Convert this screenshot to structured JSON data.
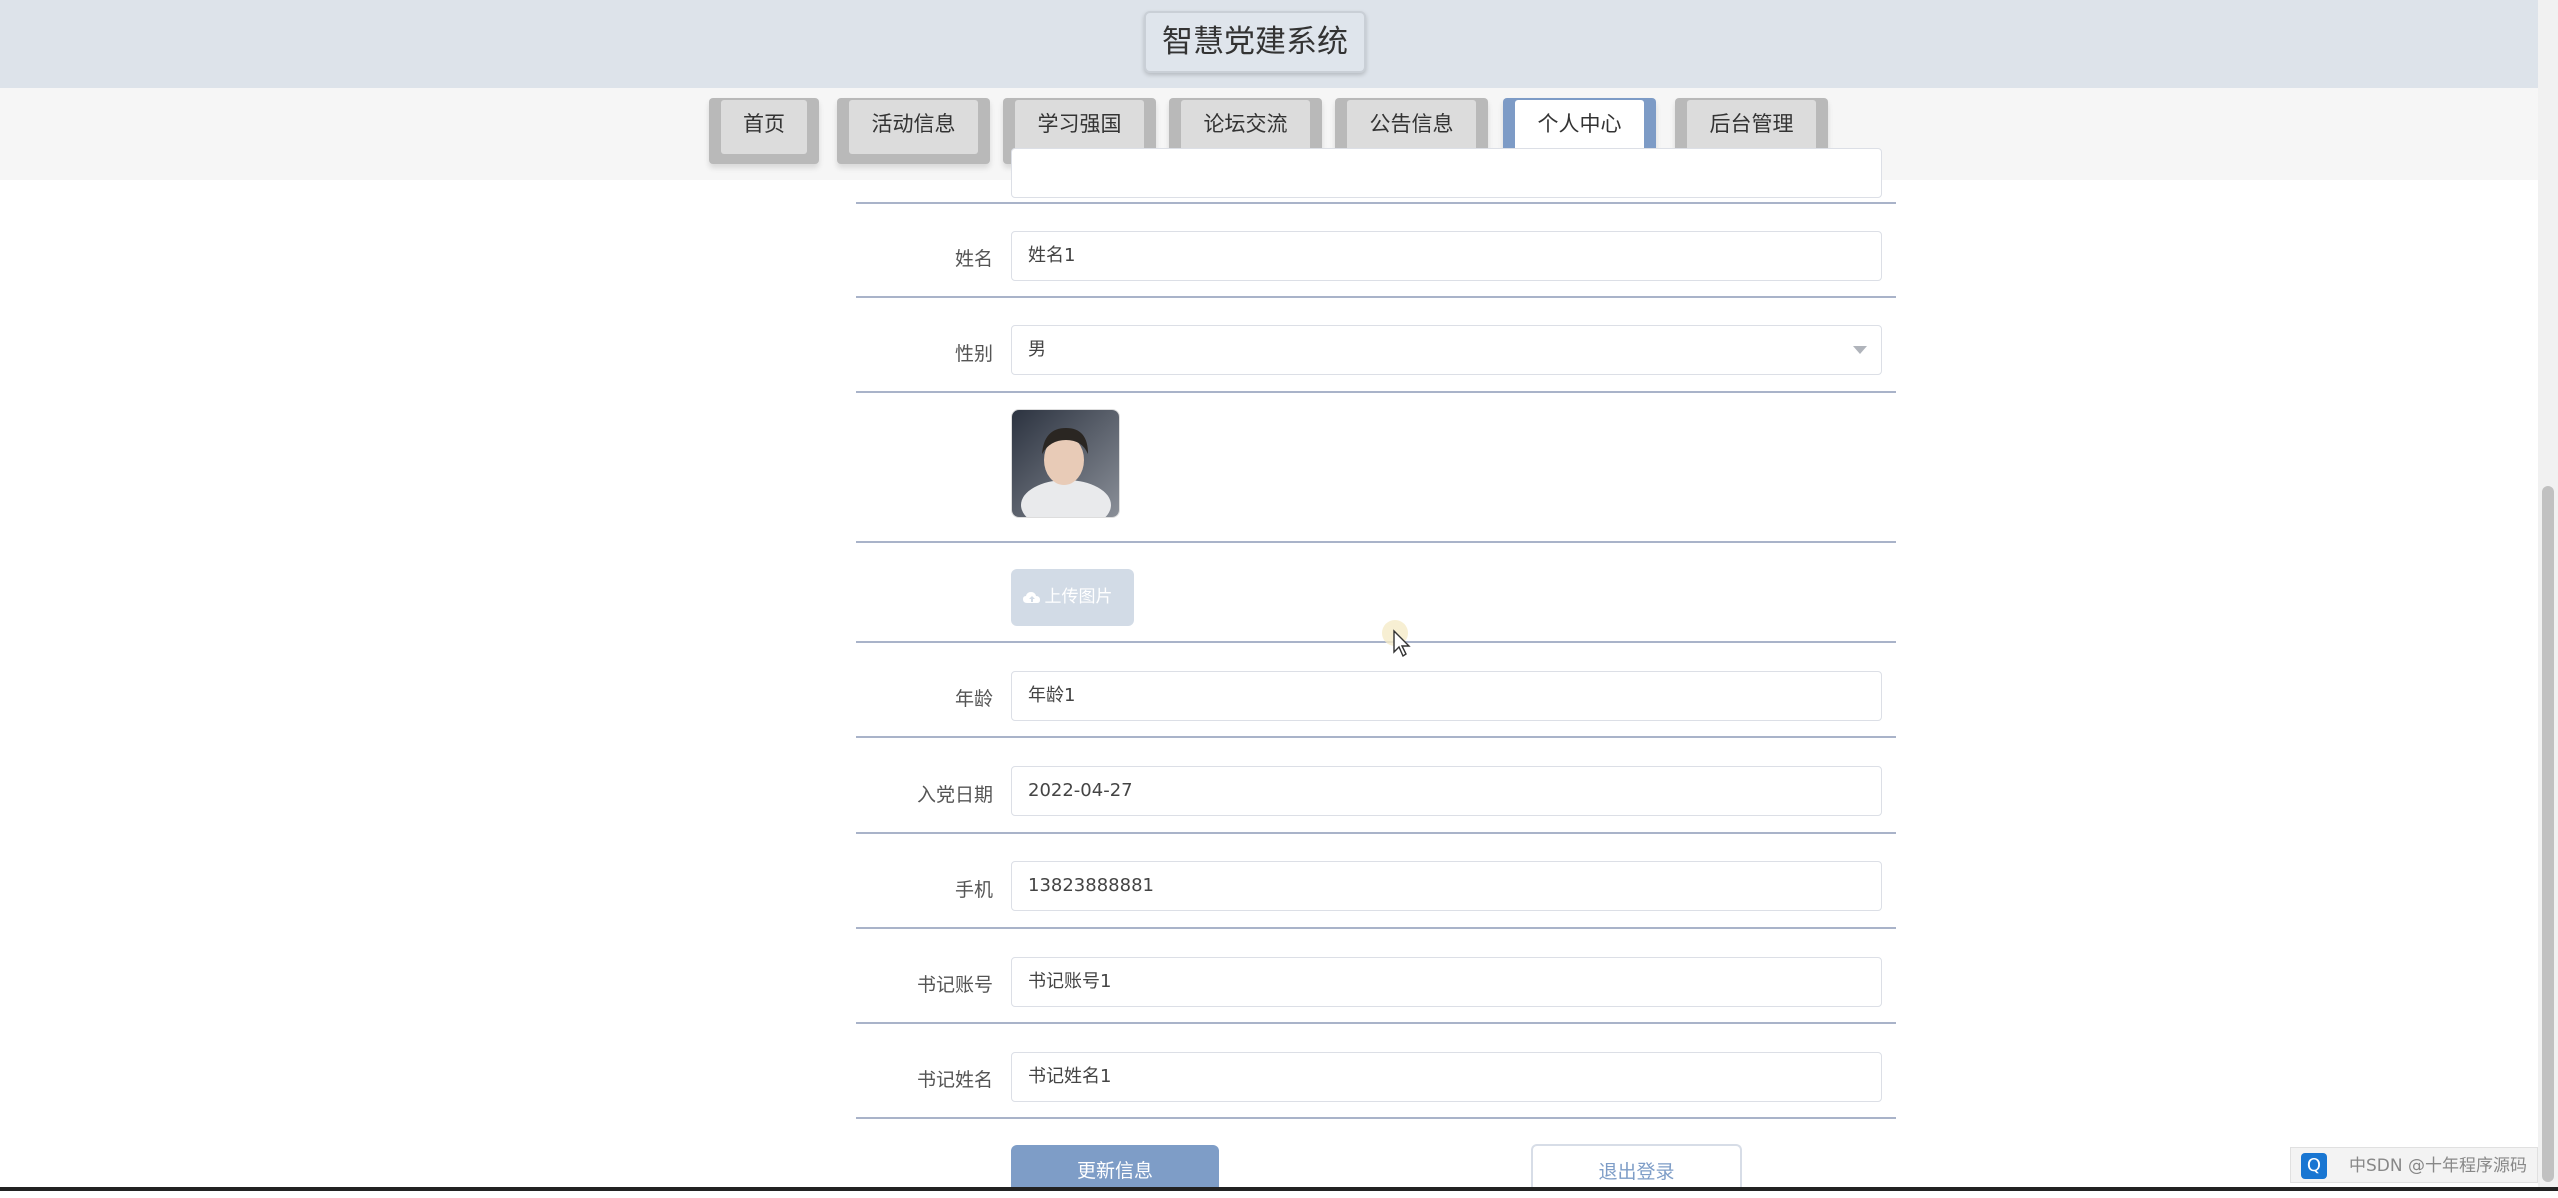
{
  "header": {
    "title": "智慧党建系统"
  },
  "nav": {
    "items": [
      {
        "label": "首页"
      },
      {
        "label": "活动信息"
      },
      {
        "label": "学习强国"
      },
      {
        "label": "论坛交流"
      },
      {
        "label": "公告信息"
      },
      {
        "label": "个人中心",
        "active": true
      },
      {
        "label": "后台管理"
      }
    ]
  },
  "form": {
    "name": {
      "label": "姓名",
      "value": "姓名1"
    },
    "gender": {
      "label": "性别",
      "value": "男"
    },
    "upload": {
      "label": "上传图片"
    },
    "age": {
      "label": "年龄",
      "value": "年龄1"
    },
    "join_date": {
      "label": "入党日期",
      "value": "2022-04-27"
    },
    "phone": {
      "label": "手机",
      "value": "13823888881"
    },
    "secretary_account": {
      "label": "书记账号",
      "value": "书记账号1"
    },
    "secretary_name": {
      "label": "书记姓名",
      "value": "书记姓名1"
    }
  },
  "actions": {
    "update_label": "更新信息",
    "logout_label": "退出登录"
  },
  "watermark": {
    "text": "中SDN @十年程序源码"
  },
  "colors": {
    "accent": "#7e9dc7",
    "header_bg": "#dde3ea"
  }
}
